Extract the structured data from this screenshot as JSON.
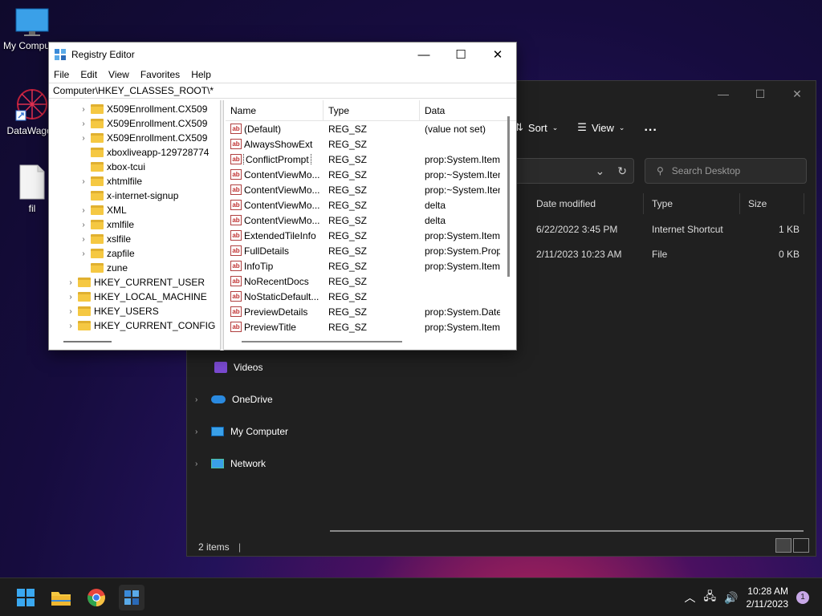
{
  "desktop": {
    "icons": [
      {
        "label": "My Computer"
      },
      {
        "label": "DataWagon"
      },
      {
        "label": "fil"
      }
    ]
  },
  "explorer": {
    "toolbar": {
      "sort": "Sort",
      "view": "View",
      "more": "..."
    },
    "search_placeholder": "Search Desktop",
    "columns": {
      "date": "Date modified",
      "type": "Type",
      "size": "Size"
    },
    "rows": [
      {
        "date": "6/22/2022 3:45 PM",
        "type": "Internet Shortcut",
        "size": "1 KB"
      },
      {
        "date": "2/11/2023 10:23 AM",
        "type": "File",
        "size": "0 KB"
      }
    ],
    "nav": [
      {
        "label": "Videos"
      },
      {
        "label": "OneDrive"
      },
      {
        "label": "My Computer"
      },
      {
        "label": "Network"
      }
    ],
    "status": "2 items"
  },
  "regedit": {
    "title": "Registry Editor",
    "menu": [
      "File",
      "Edit",
      "View",
      "Favorites",
      "Help"
    ],
    "address": "Computer\\HKEY_CLASSES_ROOT\\*",
    "tree": [
      {
        "label": "X509Enrollment.CX509"
      },
      {
        "label": "X509Enrollment.CX509"
      },
      {
        "label": "X509Enrollment.CX509"
      },
      {
        "label": "xboxliveapp-129728774"
      },
      {
        "label": "xbox-tcui"
      },
      {
        "label": "xhtmlfile"
      },
      {
        "label": "x-internet-signup"
      },
      {
        "label": "XML"
      },
      {
        "label": "xmlfile"
      },
      {
        "label": "xslfile"
      },
      {
        "label": "zapfile"
      },
      {
        "label": "zune"
      },
      {
        "label": "HKEY_CURRENT_USER"
      },
      {
        "label": "HKEY_LOCAL_MACHINE"
      },
      {
        "label": "HKEY_USERS"
      },
      {
        "label": "HKEY_CURRENT_CONFIG"
      }
    ],
    "columns": {
      "name": "Name",
      "type": "Type",
      "data": "Data"
    },
    "values": [
      {
        "name": "(Default)",
        "type": "REG_SZ",
        "data": "(value not set)"
      },
      {
        "name": "AlwaysShowExt",
        "type": "REG_SZ",
        "data": ""
      },
      {
        "name": "ConflictPrompt",
        "type": "REG_SZ",
        "data": "prop:System.Item"
      },
      {
        "name": "ContentViewMo...",
        "type": "REG_SZ",
        "data": "prop:~System.Item"
      },
      {
        "name": "ContentViewMo...",
        "type": "REG_SZ",
        "data": "prop:~System.Item"
      },
      {
        "name": "ContentViewMo...",
        "type": "REG_SZ",
        "data": "delta"
      },
      {
        "name": "ContentViewMo...",
        "type": "REG_SZ",
        "data": "delta"
      },
      {
        "name": "ExtendedTileInfo",
        "type": "REG_SZ",
        "data": "prop:System.ItemT"
      },
      {
        "name": "FullDetails",
        "type": "REG_SZ",
        "data": "prop:System.PropG"
      },
      {
        "name": "InfoTip",
        "type": "REG_SZ",
        "data": "prop:System.ItemT"
      },
      {
        "name": "NoRecentDocs",
        "type": "REG_SZ",
        "data": ""
      },
      {
        "name": "NoStaticDefault...",
        "type": "REG_SZ",
        "data": ""
      },
      {
        "name": "PreviewDetails",
        "type": "REG_SZ",
        "data": "prop:System.DateM"
      },
      {
        "name": "PreviewTitle",
        "type": "REG_SZ",
        "data": "prop:System.ItemN"
      }
    ]
  },
  "taskbar": {
    "time": "10:28 AM",
    "date": "2/11/2023",
    "notifications": "1"
  }
}
